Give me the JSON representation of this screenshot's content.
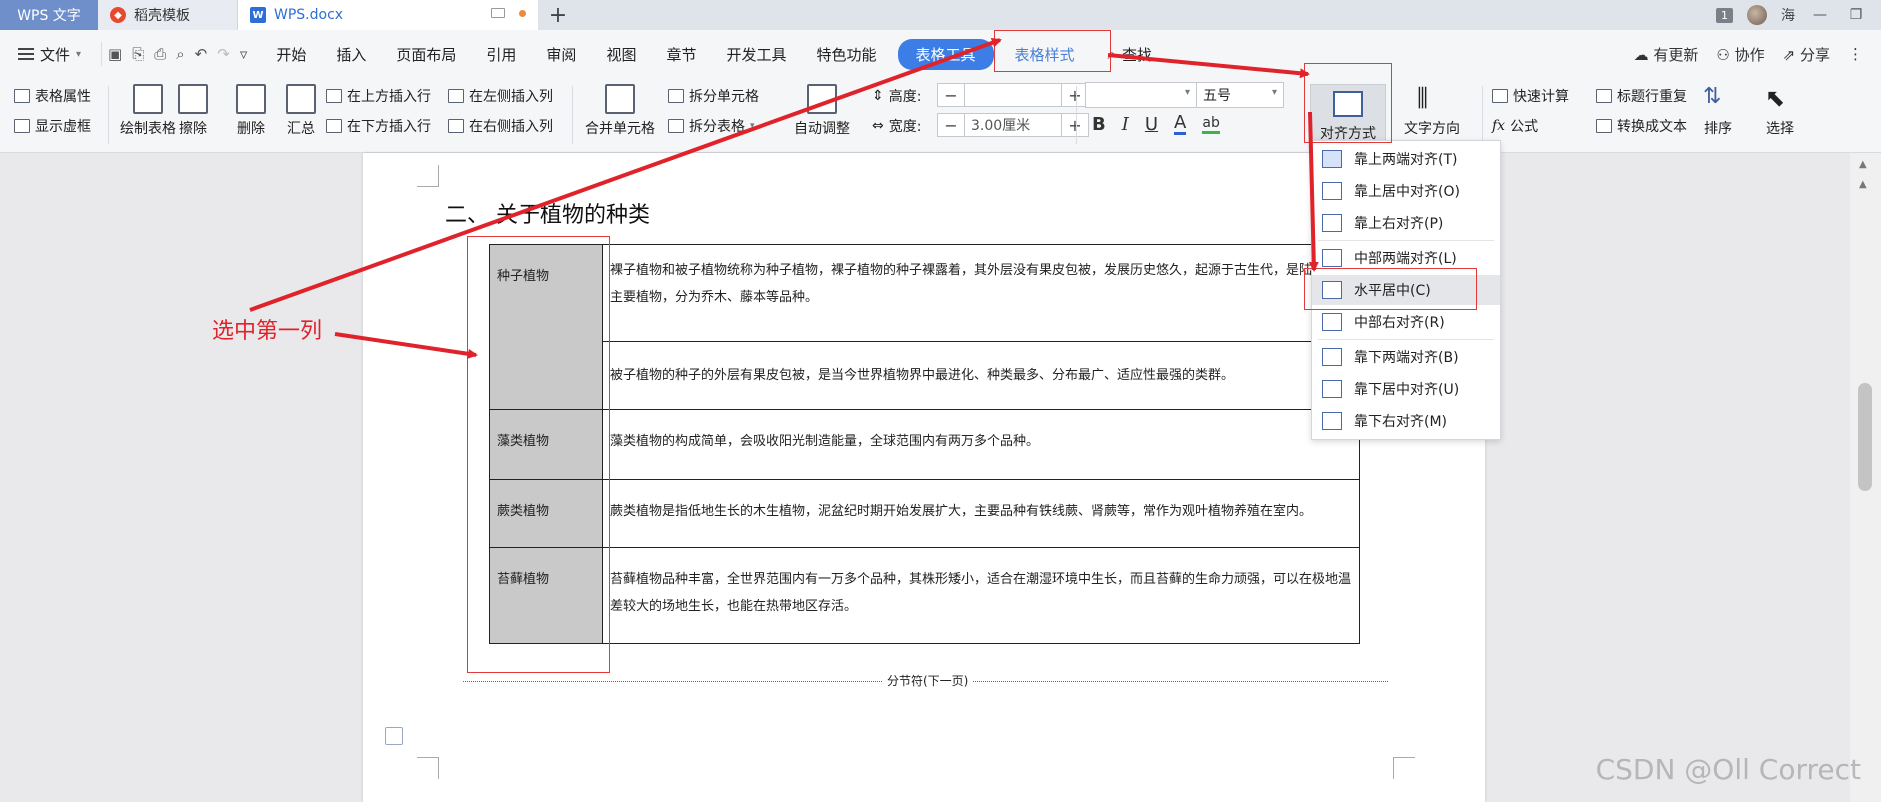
{
  "titlebar": {
    "app_tab": "WPS 文字",
    "template_tab": "稻壳模板",
    "doc_tab": "WPS.docx",
    "window_count": "1",
    "user_name": "海"
  },
  "menubar": {
    "file": "文件",
    "items": [
      "开始",
      "插入",
      "页面布局",
      "引用",
      "审阅",
      "视图",
      "章节",
      "开发工具",
      "特色功能",
      "表格工具",
      "表格样式"
    ],
    "search": "查找",
    "update": "有更新",
    "collab": "协作",
    "share": "分享"
  },
  "ribbon": {
    "table_props": "表格属性",
    "show_grid": "显示虚框",
    "draw_table": "绘制表格",
    "erase": "擦除",
    "delete": "删除",
    "summary": "汇总",
    "insert_above": "在上方插入行",
    "insert_below": "在下方插入行",
    "insert_left": "在左侧插入列",
    "insert_right": "在右侧插入列",
    "merge_cells": "合并单元格",
    "split_cells": "拆分单元格",
    "split_table": "拆分表格",
    "auto_adjust": "自动调整",
    "height_label": "高度:",
    "width_label": "宽度:",
    "width_value": "3.00厘米",
    "font_size": "五号",
    "align": "对齐方式",
    "text_dir": "文字方向",
    "quick_calc": "快速计算",
    "formula": "公式",
    "repeat_header": "标题行重复",
    "convert_text": "转换成文本",
    "sort": "排序",
    "select": "选择"
  },
  "dropdown": {
    "items": [
      "靠上两端对齐(T)",
      "靠上居中对齐(O)",
      "靠上右对齐(P)",
      "中部两端对齐(L)",
      "水平居中(C)",
      "中部右对齐(R)",
      "靠下两端对齐(B)",
      "靠下居中对齐(U)",
      "靠下右对齐(M)"
    ]
  },
  "document": {
    "heading": "二、 关于植物的种类",
    "rows": [
      {
        "name": "种子植物",
        "desc": "裸子植物和被子植物统称为种子植物，裸子植物的种子裸露着，其外层没有果皮包被，发展历史悠久，起源于古生代，是陆地上的主要植物，分为乔木、藤本等品种。"
      },
      {
        "name": "",
        "desc": "被子植物的种子的外层有果皮包被，是当今世界植物界中最进化、种类最多、分布最广、适应性最强的类群。"
      },
      {
        "name": "藻类植物",
        "desc": "藻类植物的构成简单，会吸收阳光制造能量，全球范围内有两万多个品种。"
      },
      {
        "name": "蕨类植物",
        "desc": "蕨类植物是指低地生长的木生植物，泥盆纪时期开始发展扩大，主要品种有铁线蕨、肾蕨等，常作为观叶植物养殖在室内。"
      },
      {
        "name": "苔藓植物",
        "desc": "苔藓植物品种丰富，全世界范围内有一万多个品种，其株形矮小，适合在潮湿环境中生长，而且苔藓的生命力顽强，可以在极地温差较大的场地生长，也能在热带地区存活。"
      }
    ],
    "section_break": "分节符(下一页)"
  },
  "annotation": {
    "label": "选中第一列",
    "color": "#e0222a"
  },
  "watermark": "CSDN @Oll Correct"
}
